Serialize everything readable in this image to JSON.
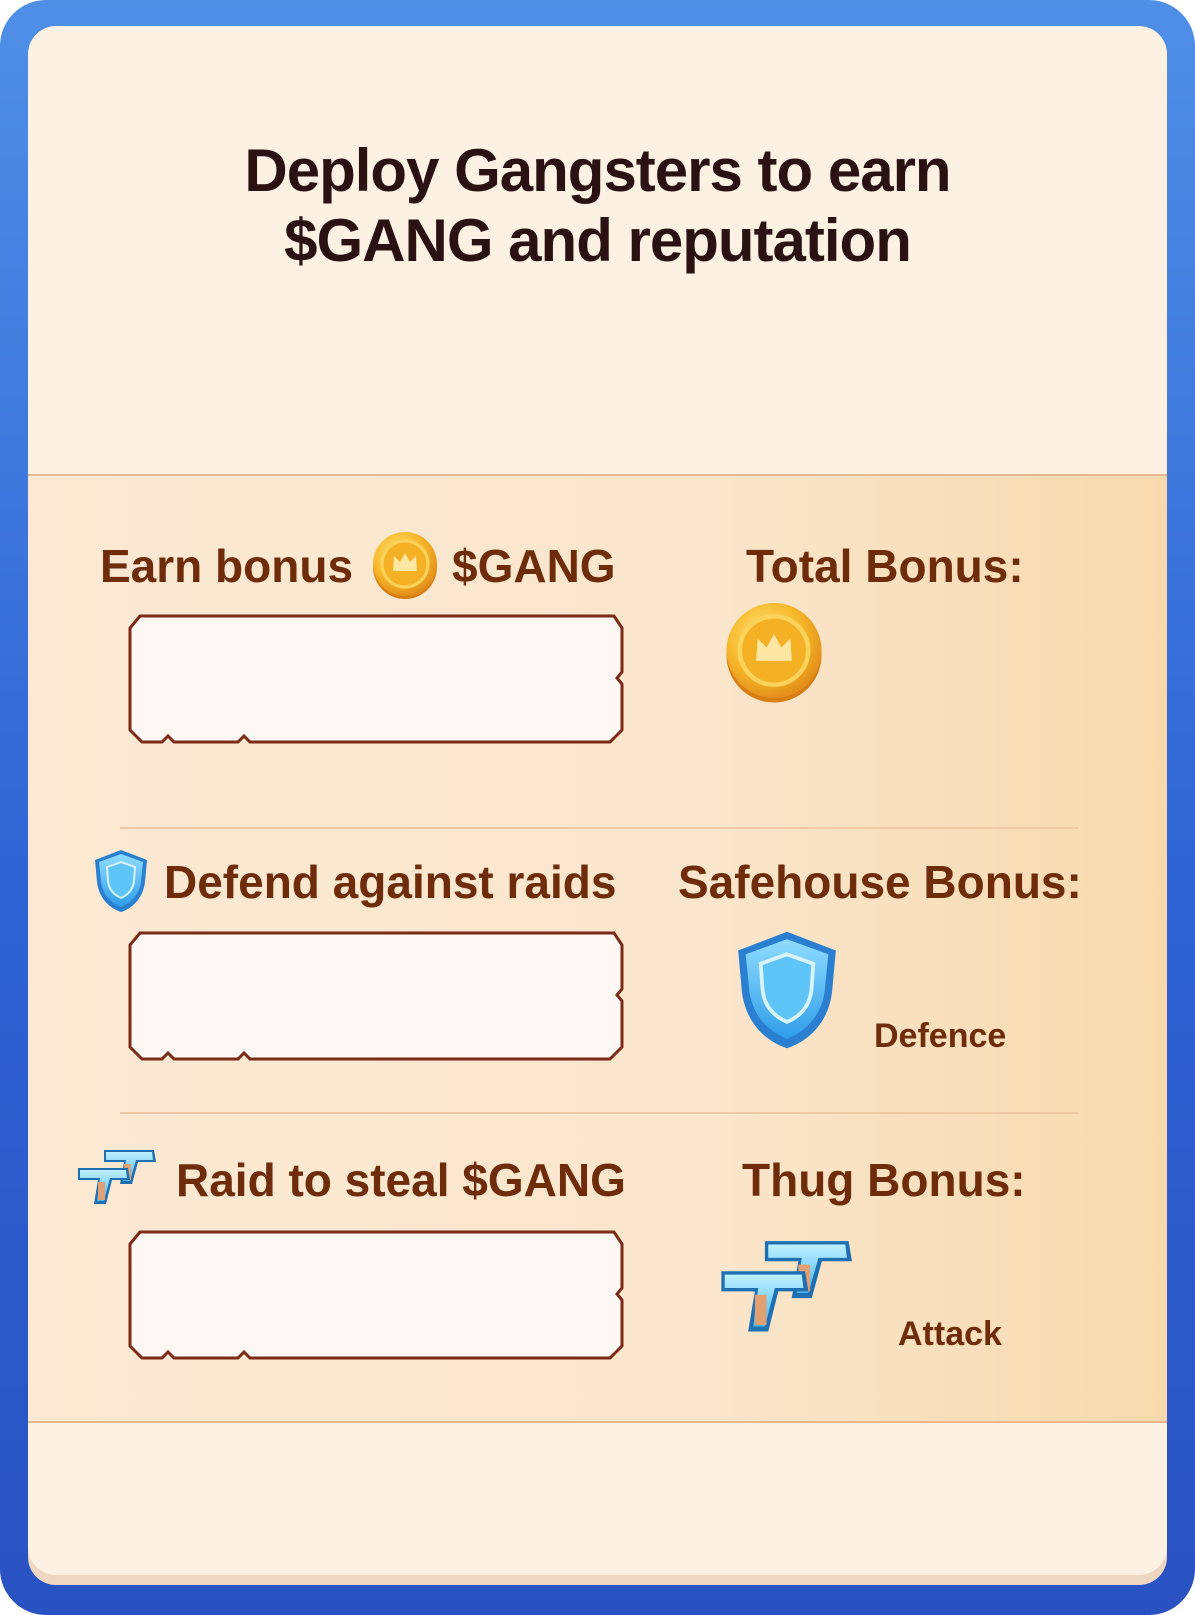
{
  "title": {
    "line1": "Deploy Gangsters to earn",
    "line2": "$GANG and reputation"
  },
  "sections": {
    "earn": {
      "prefix": "Earn bonus",
      "suffix": "$GANG",
      "icon": "gang-coin-icon",
      "input_value": "",
      "bonus_label": "Total Bonus:",
      "bonus_icon": "gang-coin-icon"
    },
    "defend": {
      "label": "Defend against raids",
      "icon": "shield-icon",
      "input_value": "",
      "bonus_label": "Safehouse Bonus:",
      "bonus_icon": "shield-icon",
      "bonus_stat": "Defence"
    },
    "raid": {
      "label": "Raid to steal $GANG",
      "icon": "pistols-icon",
      "input_value": "",
      "bonus_label": "Thug Bonus:",
      "bonus_icon": "pistols-icon",
      "bonus_stat": "Attack"
    }
  },
  "colors": {
    "frame": "#2f63d4",
    "panel": "#fcf1e3",
    "band": "#fae6cc",
    "title_text": "#2a1213",
    "label_text": "#6e2c0a",
    "input_border": "#7b2a18"
  }
}
